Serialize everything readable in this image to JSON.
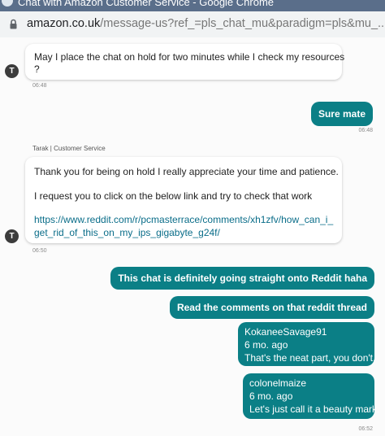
{
  "window": {
    "title": "Chat with Amazon Customer Service - Google Chrome"
  },
  "browser": {
    "url_domain": "amazon.co.uk",
    "url_path": "/message-us?ref_=pls_chat_mu&paradigm=pls&mu_..."
  },
  "chat": {
    "msg1": {
      "avatar_initial": "T",
      "text_line1": "May I place the chat on hold for two minutes while I check my resources",
      "text_line2": "?",
      "time": "06:48"
    },
    "reply1": {
      "text": "Sure mate",
      "time": "06:48"
    },
    "agent_name": "Tarak | Customer Service",
    "msg2": {
      "avatar_initial": "T",
      "para1": "Thank you for being on hold I really appreciate your time and patience.",
      "para2": "I request you to click on the below link and try to check that work",
      "link_line1": "https://www.reddit.com/r/pcmasterrace/comments/xh1zfv/how_can_i_",
      "link_line2": "get_rid_of_this_on_my_ips_gigabyte_g24f/",
      "time": "06:50"
    },
    "reply2": {
      "text": "This chat is definitely going straight onto Reddit haha"
    },
    "reply3": {
      "text": "Read the comments on that reddit thread"
    },
    "reply4": {
      "user": "KokaneeSavage91",
      "age": "6 mo. ago",
      "text": "That's the neat part, you don't."
    },
    "reply5": {
      "user": "colonelmaize",
      "age": "6 mo. ago",
      "text": "Let's just call it a beauty mark.",
      "time": "06:52"
    }
  },
  "colors": {
    "user_bubble": "#0b7f86",
    "link": "#0a6d89",
    "agent_bubble": "#ffffff"
  }
}
